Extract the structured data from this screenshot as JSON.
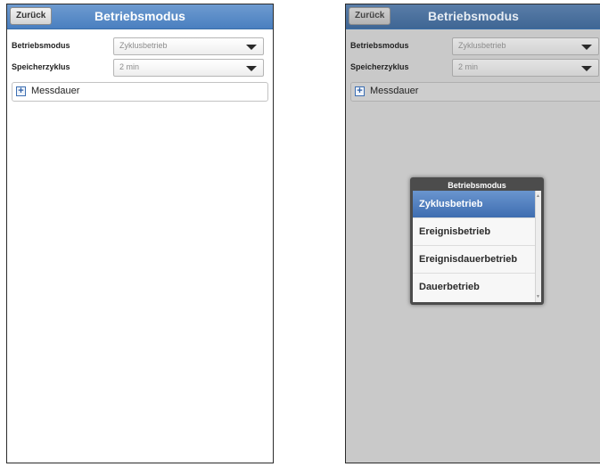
{
  "left": {
    "back_label": "Zurück",
    "title": "Betriebsmodus",
    "fields": [
      {
        "label": "Betriebsmodus",
        "value": "Zyklusbetrieb"
      },
      {
        "label": "Speicherzyklus",
        "value": "2 min"
      }
    ],
    "section": {
      "icon": "+",
      "label": "Messdauer"
    }
  },
  "right": {
    "back_label": "Zurück",
    "title": "Betriebsmodus",
    "fields": [
      {
        "label": "Betriebsmodus",
        "value": "Zyklusbetrieb"
      },
      {
        "label": "Speicherzyklus",
        "value": "2 min"
      }
    ],
    "section": {
      "icon": "+",
      "label": "Messdauer"
    },
    "popup": {
      "title": "Betriebsmodus",
      "options": [
        "Zyklusbetrieb",
        "Ereignisbetrieb",
        "Ereignisdauerbetrieb",
        "Dauerbetrieb"
      ],
      "selected": "Zyklusbetrieb"
    }
  },
  "colors": {
    "header_blue": "#4a7fc0",
    "header_blue_dimmed": "#3f6694",
    "selected_option": "#4c7ec0",
    "overlay_gray": "#c9c9c9"
  }
}
